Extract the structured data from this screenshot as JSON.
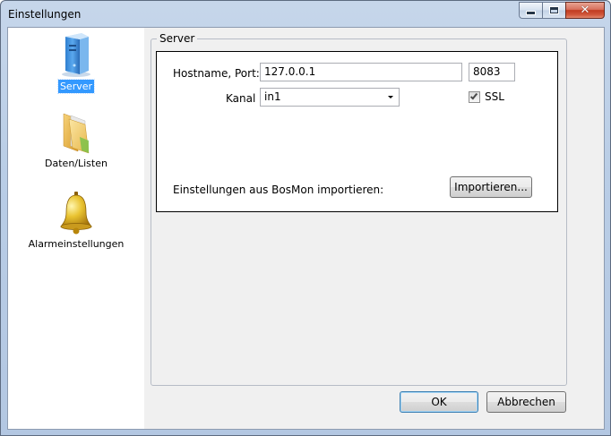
{
  "window": {
    "title": "Einstellungen",
    "controls": {
      "minimize_icon": "minimize-icon",
      "maximize_icon": "maximize-icon",
      "close_icon": "close-icon",
      "close_glyph": "✕"
    }
  },
  "sidebar": {
    "items": [
      {
        "label": "Server",
        "icon": "server-icon",
        "selected": true
      },
      {
        "label": "Daten/Listen",
        "icon": "folder-icon",
        "selected": false
      },
      {
        "label": "Alarmeinstellungen",
        "icon": "bell-icon",
        "selected": false
      }
    ]
  },
  "server_group": {
    "legend": "Server",
    "hostname_label": "Hostname, Port:",
    "hostname_value": "127.0.0.1",
    "port_value": "8083",
    "channel_label": "Kanal",
    "channel_value": "in1",
    "ssl_label": "SSL",
    "ssl_checked": true,
    "import_label": "Einstellungen aus BosMon importieren:",
    "import_button": "Importieren..."
  },
  "footer": {
    "ok_button": "OK",
    "cancel_button": "Abbrechen"
  }
}
